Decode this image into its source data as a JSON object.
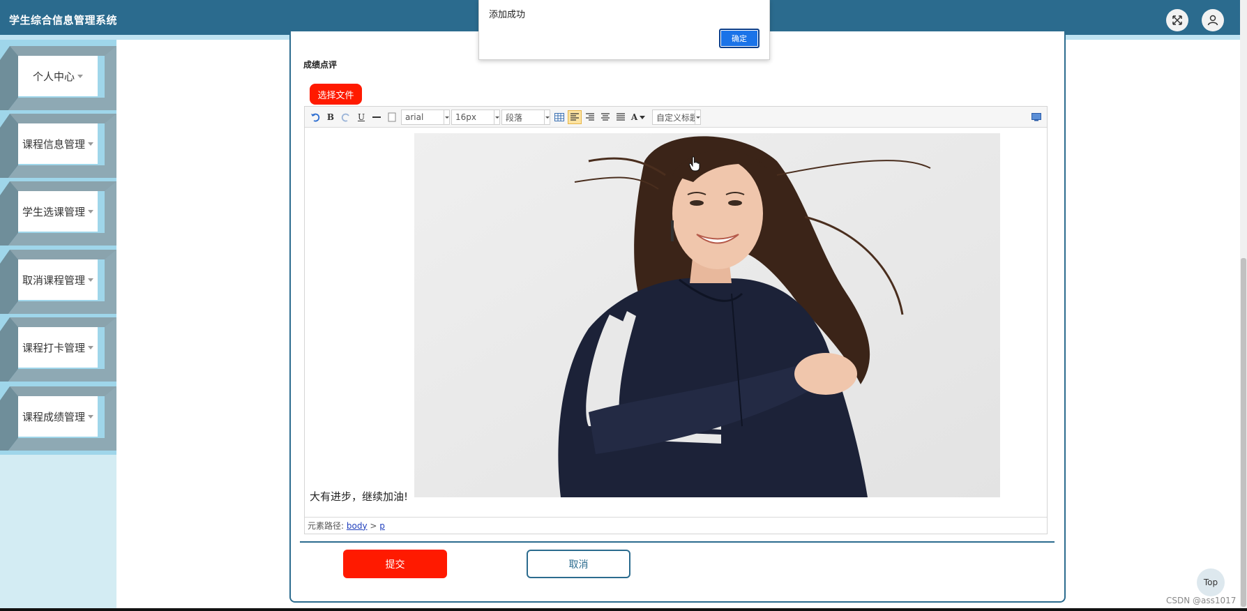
{
  "header": {
    "title": "学生综合信息管理系统",
    "fullscreen_icon": "fullscreen-icon",
    "user_icon": "user-icon"
  },
  "sidebar": {
    "items": [
      {
        "label": "个人中心"
      },
      {
        "label": "课程信息管理"
      },
      {
        "label": "学生选课管理"
      },
      {
        "label": "取消课程管理"
      },
      {
        "label": "课程打卡管理"
      },
      {
        "label": "课程成绩管理"
      }
    ]
  },
  "form": {
    "field_label": "成绩点评",
    "choose_file_label": "选择文件",
    "editor": {
      "font_family": "arial",
      "font_size": "16px",
      "paragraph": "段落",
      "custom_heading": "自定义标题",
      "content_text": "大有进步，继续加油!",
      "path_label": "元素路径:",
      "path_body": "body",
      "path_sep": ">",
      "path_p": "p"
    },
    "submit_label": "提交",
    "cancel_label": "取消"
  },
  "alert": {
    "message": "添加成功",
    "ok_label": "确定"
  },
  "top_button": "Top",
  "watermark": "CSDN @ass1017",
  "colors": {
    "header": "#2b6b8e",
    "primary_red": "#ff1a00",
    "sidebar": "#9fd6ea",
    "alert_button": "#1a73e8"
  }
}
